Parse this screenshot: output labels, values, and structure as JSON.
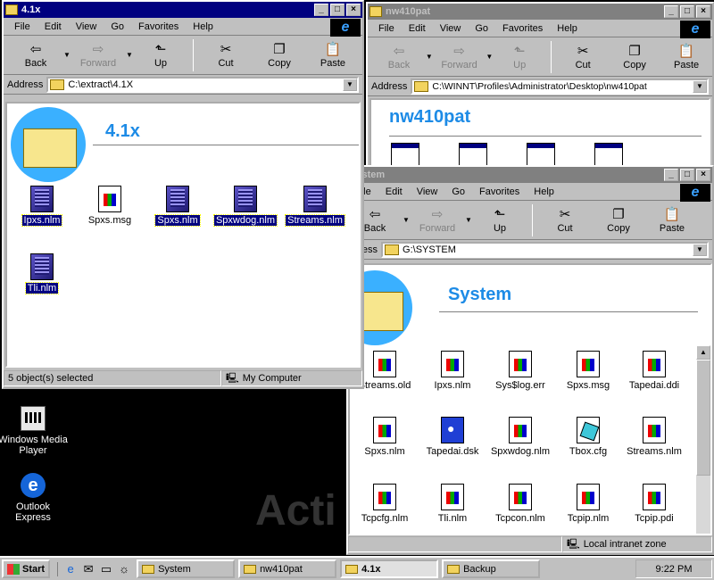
{
  "windows": {
    "w41x": {
      "title": "4.1x",
      "menu": [
        "File",
        "Edit",
        "View",
        "Go",
        "Favorites",
        "Help"
      ],
      "toolbar": {
        "back": "Back",
        "forward": "Forward",
        "up": "Up",
        "cut": "Cut",
        "copy": "Copy",
        "paste": "Paste"
      },
      "address_label": "Address",
      "address_value": "C:\\extract\\4.1X",
      "heading": "4.1x",
      "files": [
        {
          "name": "Ipxs.nlm",
          "icon": "nlm-file-icon",
          "selected": true
        },
        {
          "name": "Spxs.msg",
          "icon": "document-icon",
          "selected": false
        },
        {
          "name": "Spxs.nlm",
          "icon": "nlm-file-icon",
          "selected": true
        },
        {
          "name": "Spxwdog.nlm",
          "icon": "nlm-file-icon",
          "selected": true
        },
        {
          "name": "Streams.nlm",
          "icon": "nlm-file-icon",
          "selected": true
        },
        {
          "name": "Tli.nlm",
          "icon": "nlm-file-icon",
          "selected": true
        }
      ],
      "status_left": "5 object(s) selected",
      "status_right": "My Computer"
    },
    "nw410pat": {
      "title": "nw410pat",
      "menu": [
        "File",
        "Edit",
        "View",
        "Go",
        "Favorites",
        "Help"
      ],
      "toolbar": {
        "back": "Back",
        "forward": "Forward",
        "up": "Up",
        "cut": "Cut",
        "copy": "Copy",
        "paste": "Paste"
      },
      "address_label": "Address",
      "address_value": "C:\\WINNT\\Profiles\\Administrator\\Desktop\\nw410pat",
      "heading": "nw410pat"
    },
    "system": {
      "title": "System",
      "menu": [
        "File",
        "Edit",
        "View",
        "Go",
        "Favorites",
        "Help"
      ],
      "toolbar": {
        "back": "Back",
        "forward": "Forward",
        "up": "Up",
        "cut": "Cut",
        "copy": "Copy",
        "paste": "Paste"
      },
      "address_label": "ddress",
      "address_value": "G:\\SYSTEM",
      "heading": "System",
      "files": [
        {
          "name": "Streams.old",
          "icon": "document-icon"
        },
        {
          "name": "Ipxs.nlm",
          "icon": "document-icon"
        },
        {
          "name": "Sys$log.err",
          "icon": "document-icon"
        },
        {
          "name": "Spxs.msg",
          "icon": "document-icon"
        },
        {
          "name": "Tapedai.ddi",
          "icon": "document-icon"
        },
        {
          "name": "Spxs.nlm",
          "icon": "document-icon"
        },
        {
          "name": "Tapedai.dsk",
          "icon": "disk-icon"
        },
        {
          "name": "Spxwdog.nlm",
          "icon": "document-icon"
        },
        {
          "name": "Tbox.cfg",
          "icon": "config-icon"
        },
        {
          "name": "Streams.nlm",
          "icon": "document-icon"
        },
        {
          "name": "Tcpcfg.nlm",
          "icon": "document-icon"
        },
        {
          "name": "Tli.nlm",
          "icon": "document-icon"
        },
        {
          "name": "Tcpcon.nlm",
          "icon": "document-icon"
        },
        {
          "name": "Tcpip.nlm",
          "icon": "document-icon"
        },
        {
          "name": "Tcpip.pdi",
          "icon": "document-icon"
        }
      ],
      "status_zone": "Local intranet zone"
    }
  },
  "desktop": {
    "icons": [
      {
        "label": "Windows Media Player",
        "icon": "media-player-icon"
      },
      {
        "label": "Outlook Express",
        "icon": "outlook-express-icon"
      }
    ],
    "watermark": "Acti"
  },
  "taskbar": {
    "start_label": "Start",
    "quicklaunch": [
      "internet-explorer-icon",
      "outlook-icon",
      "desktop-icon",
      "channels-icon"
    ],
    "tasks": [
      {
        "label": "System",
        "active": false
      },
      {
        "label": "nw410pat",
        "active": false
      },
      {
        "label": "4.1x",
        "active": true
      },
      {
        "label": "Backup",
        "active": false
      }
    ],
    "clock": "9:22 PM"
  }
}
